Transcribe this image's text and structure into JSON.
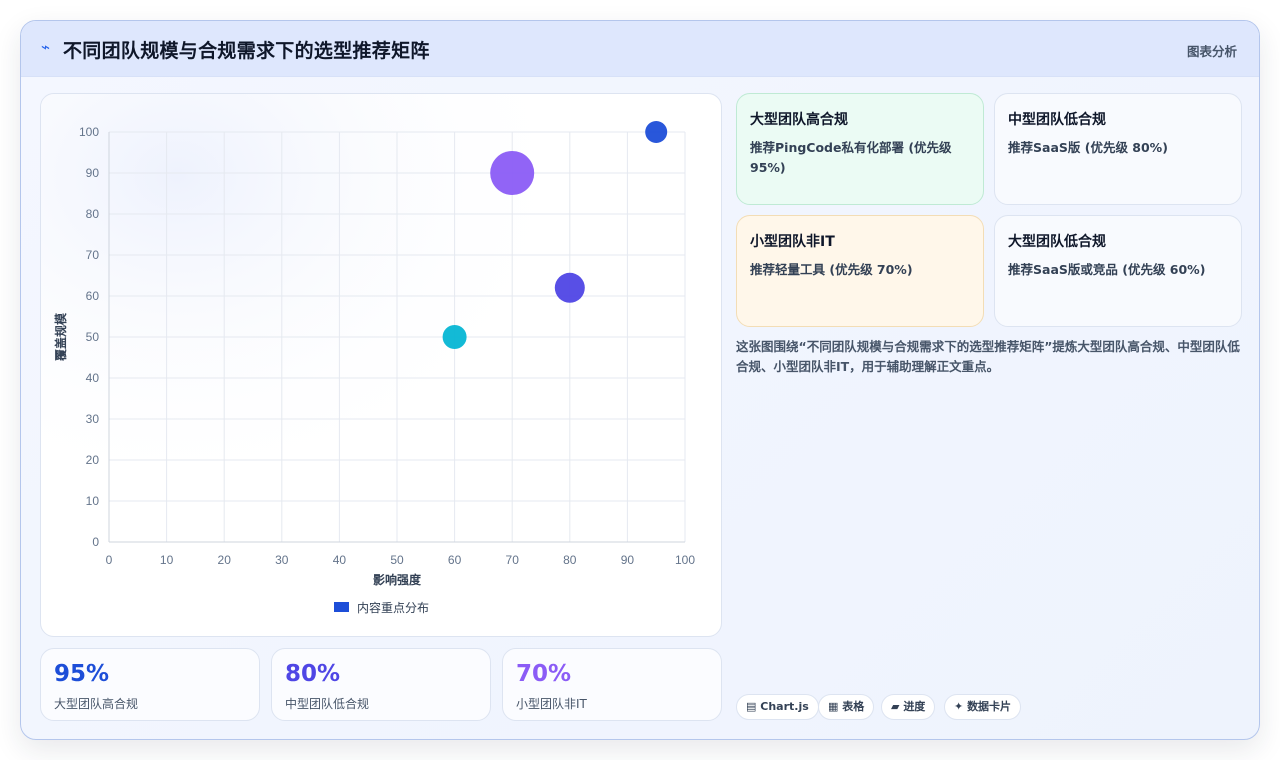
{
  "header": {
    "icon": "lightning-icon",
    "title": "不同团队规模与合规需求下的选型推荐矩阵",
    "tag": "图表分析"
  },
  "colors": {
    "blue": "#1d4ed8",
    "violet": "#4f46e5",
    "purple": "#8b5cf6",
    "cyan": "#06b6d4",
    "green_card": "#ebfbf4",
    "orange_card": "#fff7ea"
  },
  "chart_data": {
    "type": "bubble",
    "xlabel": "影响强度",
    "ylabel": "覆盖规模",
    "xlim": [
      0,
      100
    ],
    "ylim": [
      0,
      100
    ],
    "xticks": [
      0,
      10,
      20,
      30,
      40,
      50,
      60,
      70,
      80,
      90,
      100
    ],
    "yticks": [
      0,
      10,
      20,
      30,
      40,
      50,
      60,
      70,
      80,
      90,
      100
    ],
    "grid": true,
    "legend_position": "bottom",
    "series": [
      {
        "name": "内容重点分布",
        "points": [
          {
            "x": 95,
            "y": 100,
            "r": 11,
            "color": "#1d4ed8"
          },
          {
            "x": 70,
            "y": 90,
            "r": 22,
            "color": "#8b5cf6"
          },
          {
            "x": 80,
            "y": 62,
            "r": 15,
            "color": "#4f46e5"
          },
          {
            "x": 60,
            "y": 50,
            "r": 12,
            "color": "#06b6d4"
          }
        ]
      }
    ]
  },
  "stats": [
    {
      "value": "95%",
      "label": "大型团队高合规",
      "color": "#1d4ed8"
    },
    {
      "value": "80%",
      "label": "中型团队低合规",
      "color": "#4f46e5"
    },
    {
      "value": "70%",
      "label": "小型团队非IT",
      "color": "#8b5cf6"
    }
  ],
  "cards": [
    {
      "title": "大型团队高合规",
      "desc": "推荐PingCode私有化部署 (优先级 95%)"
    },
    {
      "title": "中型团队低合规",
      "desc": "推荐SaaS版 (优先级 80%)"
    },
    {
      "title": "小型团队非IT",
      "desc": "推荐轻量工具 (优先级 70%)"
    },
    {
      "title": "大型团队低合规",
      "desc": "推荐SaaS版或竞品 (优先级 60%)"
    }
  ],
  "description": "这张图围绕“不同团队规模与合规需求下的选型推荐矩阵”提炼大型团队高合规、中型团队低合规、小型团队非IT，用于辅助理解正文重点。",
  "chips": [
    {
      "icon": "chart-icon",
      "glyph": "▤",
      "label": "Chart.js"
    },
    {
      "icon": "table-icon",
      "glyph": "▦",
      "label": "表格"
    },
    {
      "icon": "progress-icon",
      "glyph": "▰",
      "label": "进度"
    },
    {
      "icon": "sparkle-icon",
      "glyph": "✦",
      "label": "数据卡片"
    }
  ]
}
